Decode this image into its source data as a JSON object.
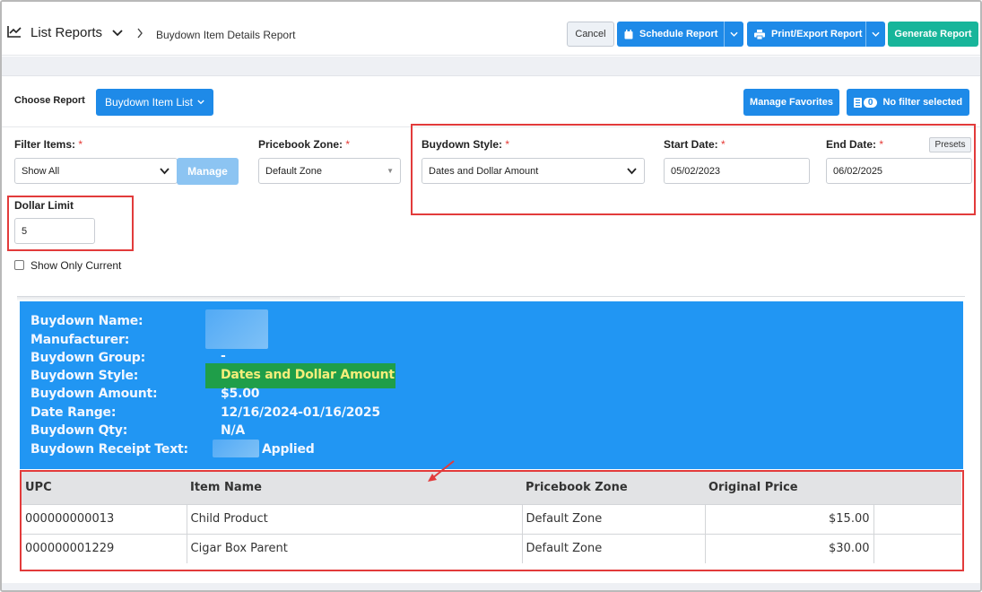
{
  "header": {
    "title": "List Reports",
    "breadcrumb": "Buydown Item Details Report",
    "cancel_label": "Cancel",
    "schedule_label": "Schedule Report",
    "print_label": "Print/Export Report",
    "generate_label": "Generate Report"
  },
  "choose": {
    "label": "Choose Report",
    "report_button": "Buydown Item List",
    "manage_favorites": "Manage Favorites",
    "filter_count": "0",
    "filter_text": "No filter selected"
  },
  "filters": {
    "filter_items_label": "Filter Items:",
    "filter_items_value": "Show All",
    "manage_label": "Manage",
    "pricebook_zone_label": "Pricebook Zone:",
    "pricebook_zone_value": "Default Zone",
    "buydown_style_label": "Buydown Style:",
    "buydown_style_value": "Dates and Dollar Amount",
    "start_date_label": "Start Date:",
    "start_date_value": "05/02/2023",
    "end_date_label": "End Date:",
    "end_date_value": "06/02/2025",
    "presets_label": "Presets",
    "dollar_limit_label": "Dollar Limit",
    "dollar_limit_value": "5",
    "show_only_current_label": "Show Only Current",
    "required_mark": "*"
  },
  "report": {
    "labels": {
      "name": "Buydown Name:",
      "manufacturer": "Manufacturer:",
      "group": "Buydown Group:",
      "style": "Buydown Style:",
      "amount": "Buydown Amount:",
      "date_range": "Date Range:",
      "qty": "Buydown Qty:",
      "receipt_text": "Buydown Receipt Text:"
    },
    "values": {
      "group": "-",
      "style": "Dates and Dollar Amount",
      "amount": "$5.00",
      "date_range": "12/16/2024-01/16/2025",
      "qty": "N/A",
      "receipt_text": "Applied"
    },
    "columns": [
      "UPC",
      "Item Name",
      "Pricebook Zone",
      "Original Price"
    ],
    "rows": [
      {
        "upc": "000000000013",
        "item_name": "Child Product",
        "zone": "Default Zone",
        "price": "$15.00"
      },
      {
        "upc": "000000001229",
        "item_name": "Cigar Box Parent",
        "zone": "Default Zone",
        "price": "$30.00"
      }
    ]
  },
  "colors": {
    "primary": "#1e8ae8",
    "generate": "#17b59a",
    "panel": "#2196f3",
    "highlight": "#1f9e49",
    "annotation": "#e23b3b"
  }
}
